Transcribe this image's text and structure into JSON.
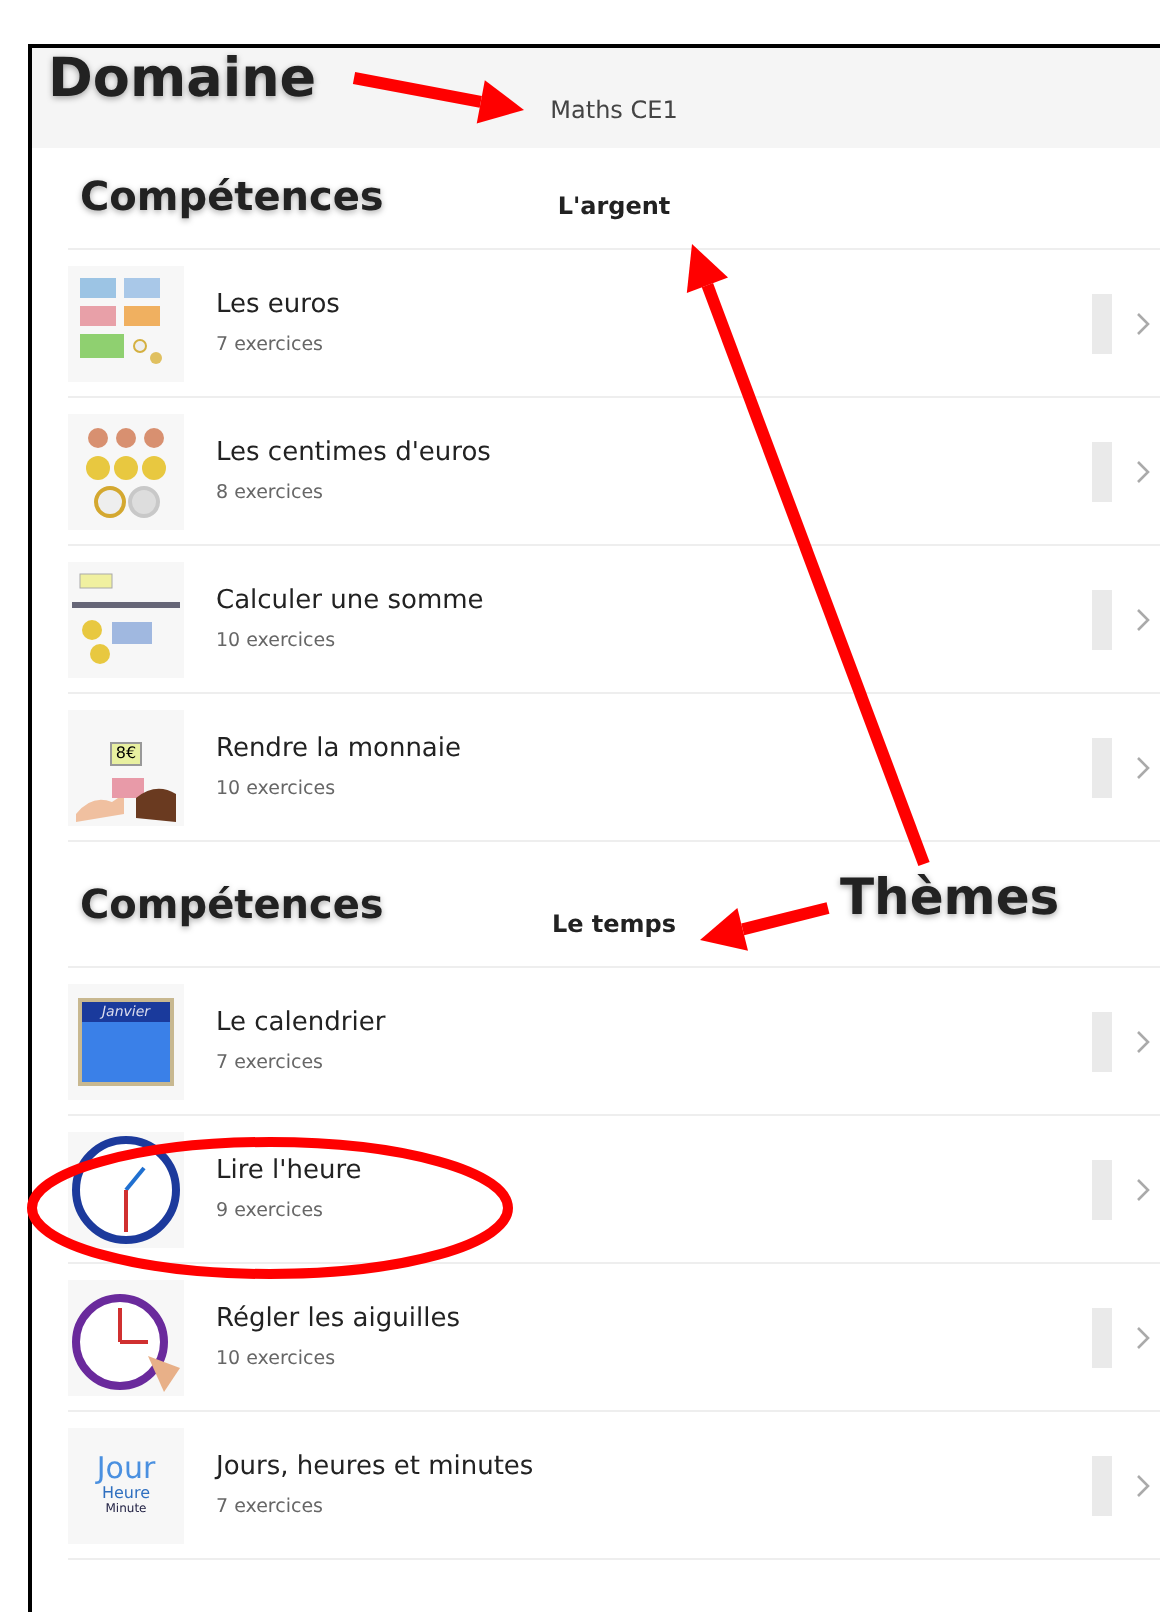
{
  "header": {
    "title": "Maths CE1"
  },
  "themes": [
    {
      "title": "L'argent",
      "skills": [
        {
          "title": "Les euros",
          "count": "7 exercices"
        },
        {
          "title": "Les centimes d'euros",
          "count": "8 exercices"
        },
        {
          "title": "Calculer une somme",
          "count": "10 exercices"
        },
        {
          "title": "Rendre la monnaie",
          "count": "10 exercices",
          "thumbnail_text": [
            "8€"
          ]
        }
      ]
    },
    {
      "title": "Le temps",
      "skills": [
        {
          "title": "Le calendrier",
          "count": "7 exercices",
          "thumbnail_text": [
            "Janvier"
          ]
        },
        {
          "title": "Lire l'heure",
          "count": "9 exercices"
        },
        {
          "title": "Régler les aiguilles",
          "count": "10 exercices"
        },
        {
          "title": "Jours, heures et minutes",
          "count": "7 exercices",
          "thumbnail_text": [
            "Jour",
            "Heure",
            "Minute"
          ]
        }
      ]
    }
  ],
  "annotations": [
    {
      "kind": "label",
      "text": "Domaine"
    },
    {
      "kind": "label",
      "text": "Thèmes"
    },
    {
      "kind": "slanted",
      "text": "Compétences"
    },
    {
      "kind": "slanted",
      "text": "Compétences"
    }
  ]
}
